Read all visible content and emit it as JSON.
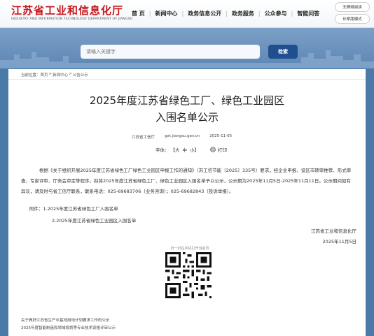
{
  "header": {
    "title": "江苏省工业和信息化厅",
    "subtitle": "INDUSTRY AND INFORMATION TECHNOLOGY DEPARTMENT OF JIANGSU",
    "nav": [
      "首  页",
      "新闻中心",
      "政务信息公开",
      "政务服务",
      "公众参与",
      "智能问答"
    ],
    "top_buttons": [
      "无障碍阅读",
      "长辈版模式"
    ]
  },
  "search": {
    "placeholder": "请输入关键字",
    "button": "检索"
  },
  "breadcrumb": {
    "prefix": "当前位置：",
    "items": [
      "首页",
      "新闻中心",
      "公告公示"
    ]
  },
  "article": {
    "title_line1": "2025年度江苏省绿色工厂、绿色工业园区",
    "title_line2": "入围名单公示",
    "source": "江苏省工信厅",
    "domain": "gxt.jiangsu.gov.cn",
    "date": "2025-11-05",
    "font_label": "字体：",
    "font_big": "【大",
    "font_mid": "中",
    "font_small": "小】",
    "print": "打印",
    "body": "根据《关于组织开展2025年度江苏省绿色工厂绿色工业园区申报工作的通知》（苏工信节能〔2025〕335号）要求，经企业申报、设区市转审推荐、形式审查、专家评审、厅务会审定等程序，拟将2025年度江苏省绿色工厂、绿色工业园区入围名单予以公示，公示期为2025年11月5日-2025年11月11日。公示期间如有异议，请及时与省工信厅联系，联系电话：025-69683706（业务咨询）；025-69682843（投诉举报）。",
    "attachment1": "附件：1.2025年度江苏省绿色工厂入围名单",
    "attachment2": "2.2025年度江苏省绿色工业园区入围名单",
    "signature_org": "江苏省工业和信息化厅",
    "signature_date": "2025年11月5日",
    "qr_caption": "扫一扫在手机打开当前页"
  },
  "related": [
    "关于做好江苏省生产业基地用地计划要求工作的公示",
    "2025年度智能制造和领域规划等专业技术资格评审公示"
  ]
}
